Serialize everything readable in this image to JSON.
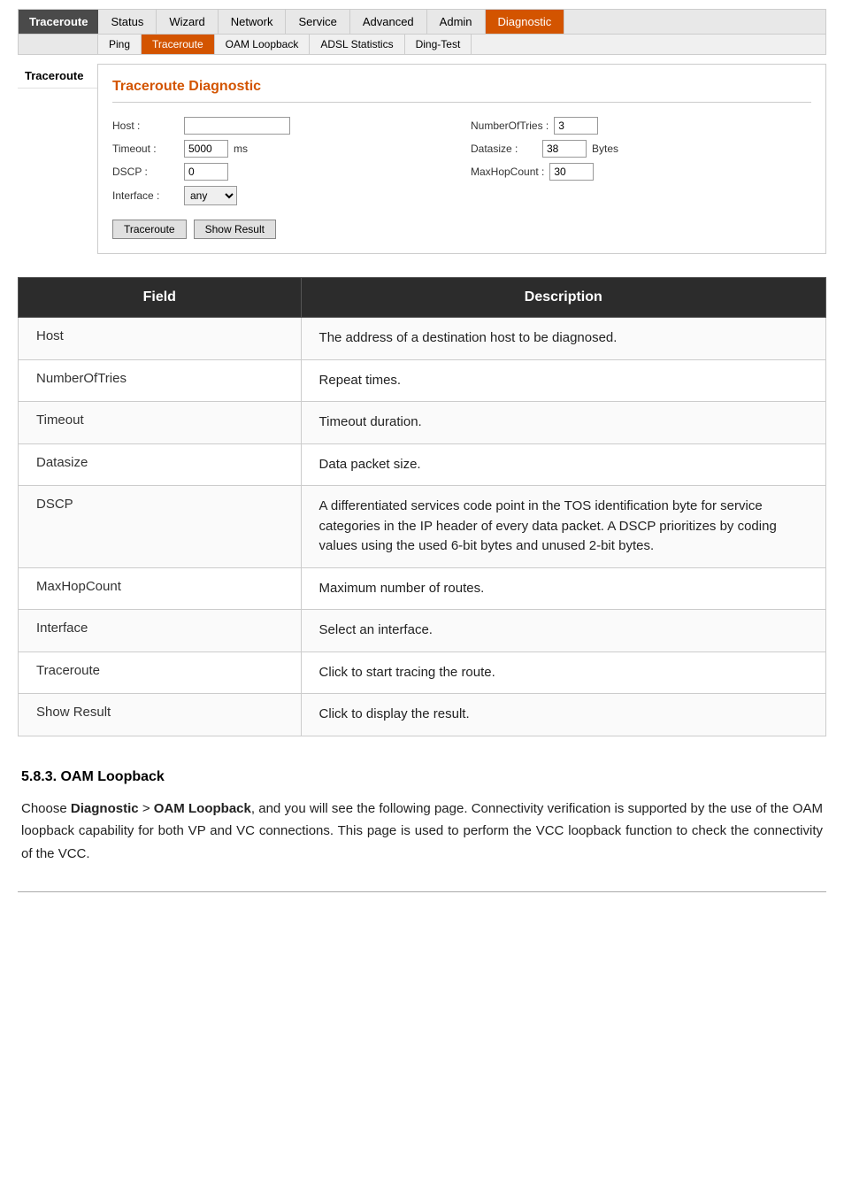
{
  "nav": {
    "label": "Traceroute",
    "tabs": [
      {
        "id": "status",
        "label": "Status",
        "active": false
      },
      {
        "id": "wizard",
        "label": "Wizard",
        "active": false
      },
      {
        "id": "network",
        "label": "Network",
        "active": false
      },
      {
        "id": "service",
        "label": "Service",
        "active": false
      },
      {
        "id": "advanced",
        "label": "Advanced",
        "active": false
      },
      {
        "id": "admin",
        "label": "Admin",
        "active": false
      },
      {
        "id": "diagnostic",
        "label": "Diagnostic",
        "active": true
      }
    ],
    "subtabs": [
      {
        "id": "ping",
        "label": "Ping",
        "active": false
      },
      {
        "id": "traceroute",
        "label": "Traceroute",
        "active": true
      },
      {
        "id": "oam-loopback",
        "label": "OAM Loopback",
        "active": false
      },
      {
        "id": "adsl-statistics",
        "label": "ADSL Statistics",
        "active": false
      },
      {
        "id": "ding-test",
        "label": "Ding-Test",
        "active": false
      }
    ]
  },
  "sidebar": {
    "items": [
      {
        "id": "traceroute",
        "label": "Traceroute",
        "active": true
      }
    ]
  },
  "panel": {
    "title": "Traceroute Diagnostic",
    "form": {
      "host_label": "Host :",
      "host_value": "",
      "numberooftries_label": "NumberOfTries :",
      "numberooftries_value": "3",
      "timeout_label": "Timeout :",
      "timeout_value": "5000",
      "timeout_unit": "ms",
      "datasize_label": "Datasize :",
      "datasize_value": "38",
      "datasize_unit": "Bytes",
      "dscp_label": "DSCP :",
      "dscp_value": "0",
      "maxhopcount_label": "MaxHopCount :",
      "maxhopcount_value": "30",
      "interface_label": "Interface :",
      "interface_value": "any",
      "interface_options": [
        "any"
      ],
      "traceroute_btn": "Traceroute",
      "show_result_btn": "Show Result"
    }
  },
  "field_table": {
    "col_field": "Field",
    "col_description": "Description",
    "rows": [
      {
        "field": "Host",
        "description": "The address of a destination host to be diagnosed."
      },
      {
        "field": "NumberOfTries",
        "description": "Repeat times."
      },
      {
        "field": "Timeout",
        "description": "Timeout duration."
      },
      {
        "field": "Datasize",
        "description": "Data packet size."
      },
      {
        "field": "DSCP",
        "description": "A differentiated services code point in the TOS identification byte for service categories in the IP header of every data packet. A DSCP prioritizes by coding values using the used 6-bit bytes and unused 2-bit bytes."
      },
      {
        "field": "MaxHopCount",
        "description": "Maximum number of routes."
      },
      {
        "field": "Interface",
        "description": "Select an interface."
      },
      {
        "field": "Traceroute",
        "description": "Click to start tracing the route."
      },
      {
        "field": "Show Result",
        "description": "Click to display the result."
      }
    ]
  },
  "bottom_section": {
    "heading": "5.8.3.      OAM Loopback",
    "text_parts": [
      {
        "text": "Choose ",
        "bold": false
      },
      {
        "text": "Diagnostic",
        "bold": true
      },
      {
        "text": " > ",
        "bold": false
      },
      {
        "text": "OAM Loopback",
        "bold": true
      },
      {
        "text": ", and you will see the following page. Connectivity verification is supported by the use of the OAM loopback capability for both VP and VC connections. This page is used to perform the VCC loopback function to check the connectivity of the VCC.",
        "bold": false
      }
    ]
  }
}
